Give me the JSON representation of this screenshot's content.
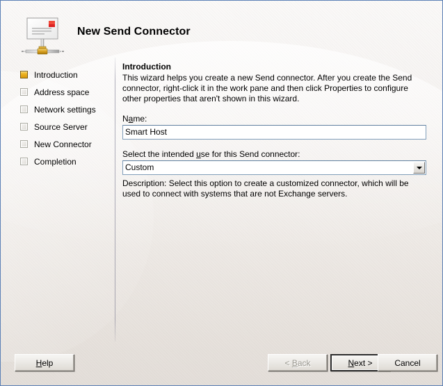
{
  "window": {
    "title": "New Send Connector",
    "icon": "send-connector-icon",
    "frame_accent": "#5a7fb5",
    "background": "#eeeae6"
  },
  "sidebar": {
    "steps": [
      {
        "label": "Introduction",
        "state": "active",
        "icon": "step-marker-active"
      },
      {
        "label": "Address space",
        "state": "pending",
        "icon": "step-marker-pending"
      },
      {
        "label": "Network settings",
        "state": "pending",
        "icon": "step-marker-pending"
      },
      {
        "label": "Source Server",
        "state": "pending",
        "icon": "step-marker-pending"
      },
      {
        "label": "New Connector",
        "state": "pending",
        "icon": "step-marker-pending"
      },
      {
        "label": "Completion",
        "state": "pending",
        "icon": "step-marker-pending"
      }
    ],
    "active_marker_color": "#e8aa18"
  },
  "content": {
    "heading": "Introduction",
    "intro_paragraph": "This wizard helps you create a new Send connector. After you create the Send connector, right-click it in the work pane and then click Properties to configure other properties that aren't shown in this wizard.",
    "name_field": {
      "label_prefix": "N",
      "label_accel": "a",
      "label_suffix": "me:",
      "value": "Smart Host",
      "placeholder": ""
    },
    "use_field": {
      "label_prefix": "Select the intended ",
      "label_accel": "u",
      "label_suffix": "se for this Send connector:",
      "selected": "Custom",
      "options": [
        "Custom"
      ],
      "dropdown_icon": "chevron-down-icon"
    },
    "description_text": "Description: Select this option to create a customized connector, which will be used to connect with systems that are not Exchange servers."
  },
  "footer": {
    "help": {
      "prefix": "",
      "accel": "H",
      "suffix": "elp",
      "enabled": true
    },
    "back": {
      "prefix": "< ",
      "accel": "B",
      "suffix": "ack",
      "enabled": false
    },
    "next": {
      "prefix": "",
      "accel": "N",
      "suffix": "ext >",
      "enabled": true,
      "is_default": true
    },
    "cancel": {
      "label": "Cancel",
      "enabled": true
    }
  }
}
